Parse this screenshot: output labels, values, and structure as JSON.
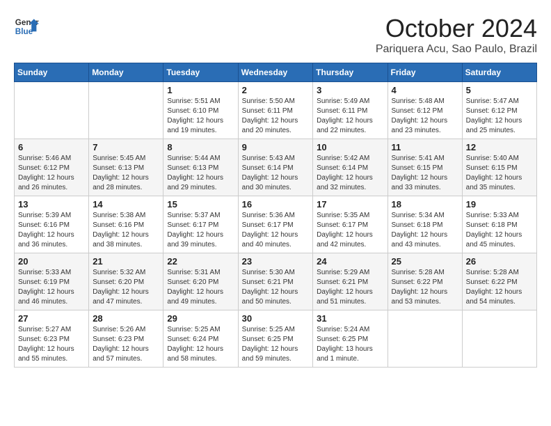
{
  "logo": {
    "text_general": "General",
    "text_blue": "Blue"
  },
  "title": "October 2024",
  "location": "Pariquera Acu, Sao Paulo, Brazil",
  "weekdays": [
    "Sunday",
    "Monday",
    "Tuesday",
    "Wednesday",
    "Thursday",
    "Friday",
    "Saturday"
  ],
  "weeks": [
    [
      {
        "day": "",
        "sunrise": "",
        "sunset": "",
        "daylight": ""
      },
      {
        "day": "",
        "sunrise": "",
        "sunset": "",
        "daylight": ""
      },
      {
        "day": "1",
        "sunrise": "Sunrise: 5:51 AM",
        "sunset": "Sunset: 6:10 PM",
        "daylight": "Daylight: 12 hours and 19 minutes."
      },
      {
        "day": "2",
        "sunrise": "Sunrise: 5:50 AM",
        "sunset": "Sunset: 6:11 PM",
        "daylight": "Daylight: 12 hours and 20 minutes."
      },
      {
        "day": "3",
        "sunrise": "Sunrise: 5:49 AM",
        "sunset": "Sunset: 6:11 PM",
        "daylight": "Daylight: 12 hours and 22 minutes."
      },
      {
        "day": "4",
        "sunrise": "Sunrise: 5:48 AM",
        "sunset": "Sunset: 6:12 PM",
        "daylight": "Daylight: 12 hours and 23 minutes."
      },
      {
        "day": "5",
        "sunrise": "Sunrise: 5:47 AM",
        "sunset": "Sunset: 6:12 PM",
        "daylight": "Daylight: 12 hours and 25 minutes."
      }
    ],
    [
      {
        "day": "6",
        "sunrise": "Sunrise: 5:46 AM",
        "sunset": "Sunset: 6:12 PM",
        "daylight": "Daylight: 12 hours and 26 minutes."
      },
      {
        "day": "7",
        "sunrise": "Sunrise: 5:45 AM",
        "sunset": "Sunset: 6:13 PM",
        "daylight": "Daylight: 12 hours and 28 minutes."
      },
      {
        "day": "8",
        "sunrise": "Sunrise: 5:44 AM",
        "sunset": "Sunset: 6:13 PM",
        "daylight": "Daylight: 12 hours and 29 minutes."
      },
      {
        "day": "9",
        "sunrise": "Sunrise: 5:43 AM",
        "sunset": "Sunset: 6:14 PM",
        "daylight": "Daylight: 12 hours and 30 minutes."
      },
      {
        "day": "10",
        "sunrise": "Sunrise: 5:42 AM",
        "sunset": "Sunset: 6:14 PM",
        "daylight": "Daylight: 12 hours and 32 minutes."
      },
      {
        "day": "11",
        "sunrise": "Sunrise: 5:41 AM",
        "sunset": "Sunset: 6:15 PM",
        "daylight": "Daylight: 12 hours and 33 minutes."
      },
      {
        "day": "12",
        "sunrise": "Sunrise: 5:40 AM",
        "sunset": "Sunset: 6:15 PM",
        "daylight": "Daylight: 12 hours and 35 minutes."
      }
    ],
    [
      {
        "day": "13",
        "sunrise": "Sunrise: 5:39 AM",
        "sunset": "Sunset: 6:16 PM",
        "daylight": "Daylight: 12 hours and 36 minutes."
      },
      {
        "day": "14",
        "sunrise": "Sunrise: 5:38 AM",
        "sunset": "Sunset: 6:16 PM",
        "daylight": "Daylight: 12 hours and 38 minutes."
      },
      {
        "day": "15",
        "sunrise": "Sunrise: 5:37 AM",
        "sunset": "Sunset: 6:17 PM",
        "daylight": "Daylight: 12 hours and 39 minutes."
      },
      {
        "day": "16",
        "sunrise": "Sunrise: 5:36 AM",
        "sunset": "Sunset: 6:17 PM",
        "daylight": "Daylight: 12 hours and 40 minutes."
      },
      {
        "day": "17",
        "sunrise": "Sunrise: 5:35 AM",
        "sunset": "Sunset: 6:17 PM",
        "daylight": "Daylight: 12 hours and 42 minutes."
      },
      {
        "day": "18",
        "sunrise": "Sunrise: 5:34 AM",
        "sunset": "Sunset: 6:18 PM",
        "daylight": "Daylight: 12 hours and 43 minutes."
      },
      {
        "day": "19",
        "sunrise": "Sunrise: 5:33 AM",
        "sunset": "Sunset: 6:18 PM",
        "daylight": "Daylight: 12 hours and 45 minutes."
      }
    ],
    [
      {
        "day": "20",
        "sunrise": "Sunrise: 5:33 AM",
        "sunset": "Sunset: 6:19 PM",
        "daylight": "Daylight: 12 hours and 46 minutes."
      },
      {
        "day": "21",
        "sunrise": "Sunrise: 5:32 AM",
        "sunset": "Sunset: 6:20 PM",
        "daylight": "Daylight: 12 hours and 47 minutes."
      },
      {
        "day": "22",
        "sunrise": "Sunrise: 5:31 AM",
        "sunset": "Sunset: 6:20 PM",
        "daylight": "Daylight: 12 hours and 49 minutes."
      },
      {
        "day": "23",
        "sunrise": "Sunrise: 5:30 AM",
        "sunset": "Sunset: 6:21 PM",
        "daylight": "Daylight: 12 hours and 50 minutes."
      },
      {
        "day": "24",
        "sunrise": "Sunrise: 5:29 AM",
        "sunset": "Sunset: 6:21 PM",
        "daylight": "Daylight: 12 hours and 51 minutes."
      },
      {
        "day": "25",
        "sunrise": "Sunrise: 5:28 AM",
        "sunset": "Sunset: 6:22 PM",
        "daylight": "Daylight: 12 hours and 53 minutes."
      },
      {
        "day": "26",
        "sunrise": "Sunrise: 5:28 AM",
        "sunset": "Sunset: 6:22 PM",
        "daylight": "Daylight: 12 hours and 54 minutes."
      }
    ],
    [
      {
        "day": "27",
        "sunrise": "Sunrise: 5:27 AM",
        "sunset": "Sunset: 6:23 PM",
        "daylight": "Daylight: 12 hours and 55 minutes."
      },
      {
        "day": "28",
        "sunrise": "Sunrise: 5:26 AM",
        "sunset": "Sunset: 6:23 PM",
        "daylight": "Daylight: 12 hours and 57 minutes."
      },
      {
        "day": "29",
        "sunrise": "Sunrise: 5:25 AM",
        "sunset": "Sunset: 6:24 PM",
        "daylight": "Daylight: 12 hours and 58 minutes."
      },
      {
        "day": "30",
        "sunrise": "Sunrise: 5:25 AM",
        "sunset": "Sunset: 6:25 PM",
        "daylight": "Daylight: 12 hours and 59 minutes."
      },
      {
        "day": "31",
        "sunrise": "Sunrise: 5:24 AM",
        "sunset": "Sunset: 6:25 PM",
        "daylight": "Daylight: 13 hours and 1 minute."
      },
      {
        "day": "",
        "sunrise": "",
        "sunset": "",
        "daylight": ""
      },
      {
        "day": "",
        "sunrise": "",
        "sunset": "",
        "daylight": ""
      }
    ]
  ]
}
